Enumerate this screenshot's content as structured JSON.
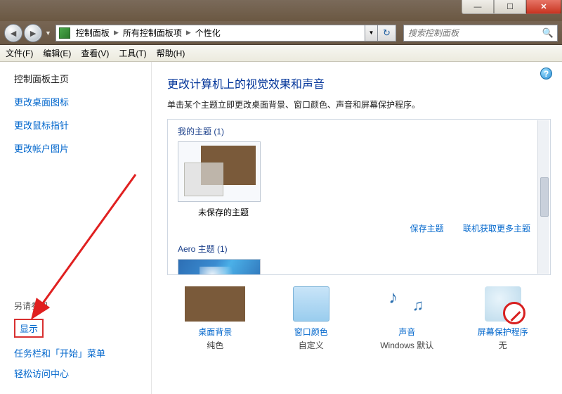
{
  "breadcrumbs": {
    "root": "控制面板",
    "mid": "所有控制面板项",
    "leaf": "个性化"
  },
  "search": {
    "placeholder": "搜索控制面板"
  },
  "menu": {
    "file": "文件(F)",
    "edit": "编辑(E)",
    "view": "查看(V)",
    "tools": "工具(T)",
    "help": "帮助(H)"
  },
  "sidebar": {
    "home": "控制面板主页",
    "links": [
      "更改桌面图标",
      "更改鼠标指针",
      "更改帐户图片"
    ],
    "also": "另请参阅",
    "display": "显示",
    "task": "任务栏和「开始」菜单",
    "ease": "轻松访问中心"
  },
  "content": {
    "heading": "更改计算机上的视觉效果和声音",
    "sub": "单击某个主题立即更改桌面背景、窗口颜色、声音和屏幕保护程序。",
    "group1": "我的主题 (1)",
    "theme_name": "未保存的主题",
    "save": "保存主题",
    "more": "联机获取更多主题",
    "group2": "Aero 主题 (1)"
  },
  "bottom": {
    "bg_l": "桌面背景",
    "bg_v": "纯色",
    "wc_l": "窗口颜色",
    "wc_v": "自定义",
    "sd_l": "声音",
    "sd_v": "Windows 默认",
    "ss_l": "屏幕保护程序",
    "ss_v": "无"
  }
}
